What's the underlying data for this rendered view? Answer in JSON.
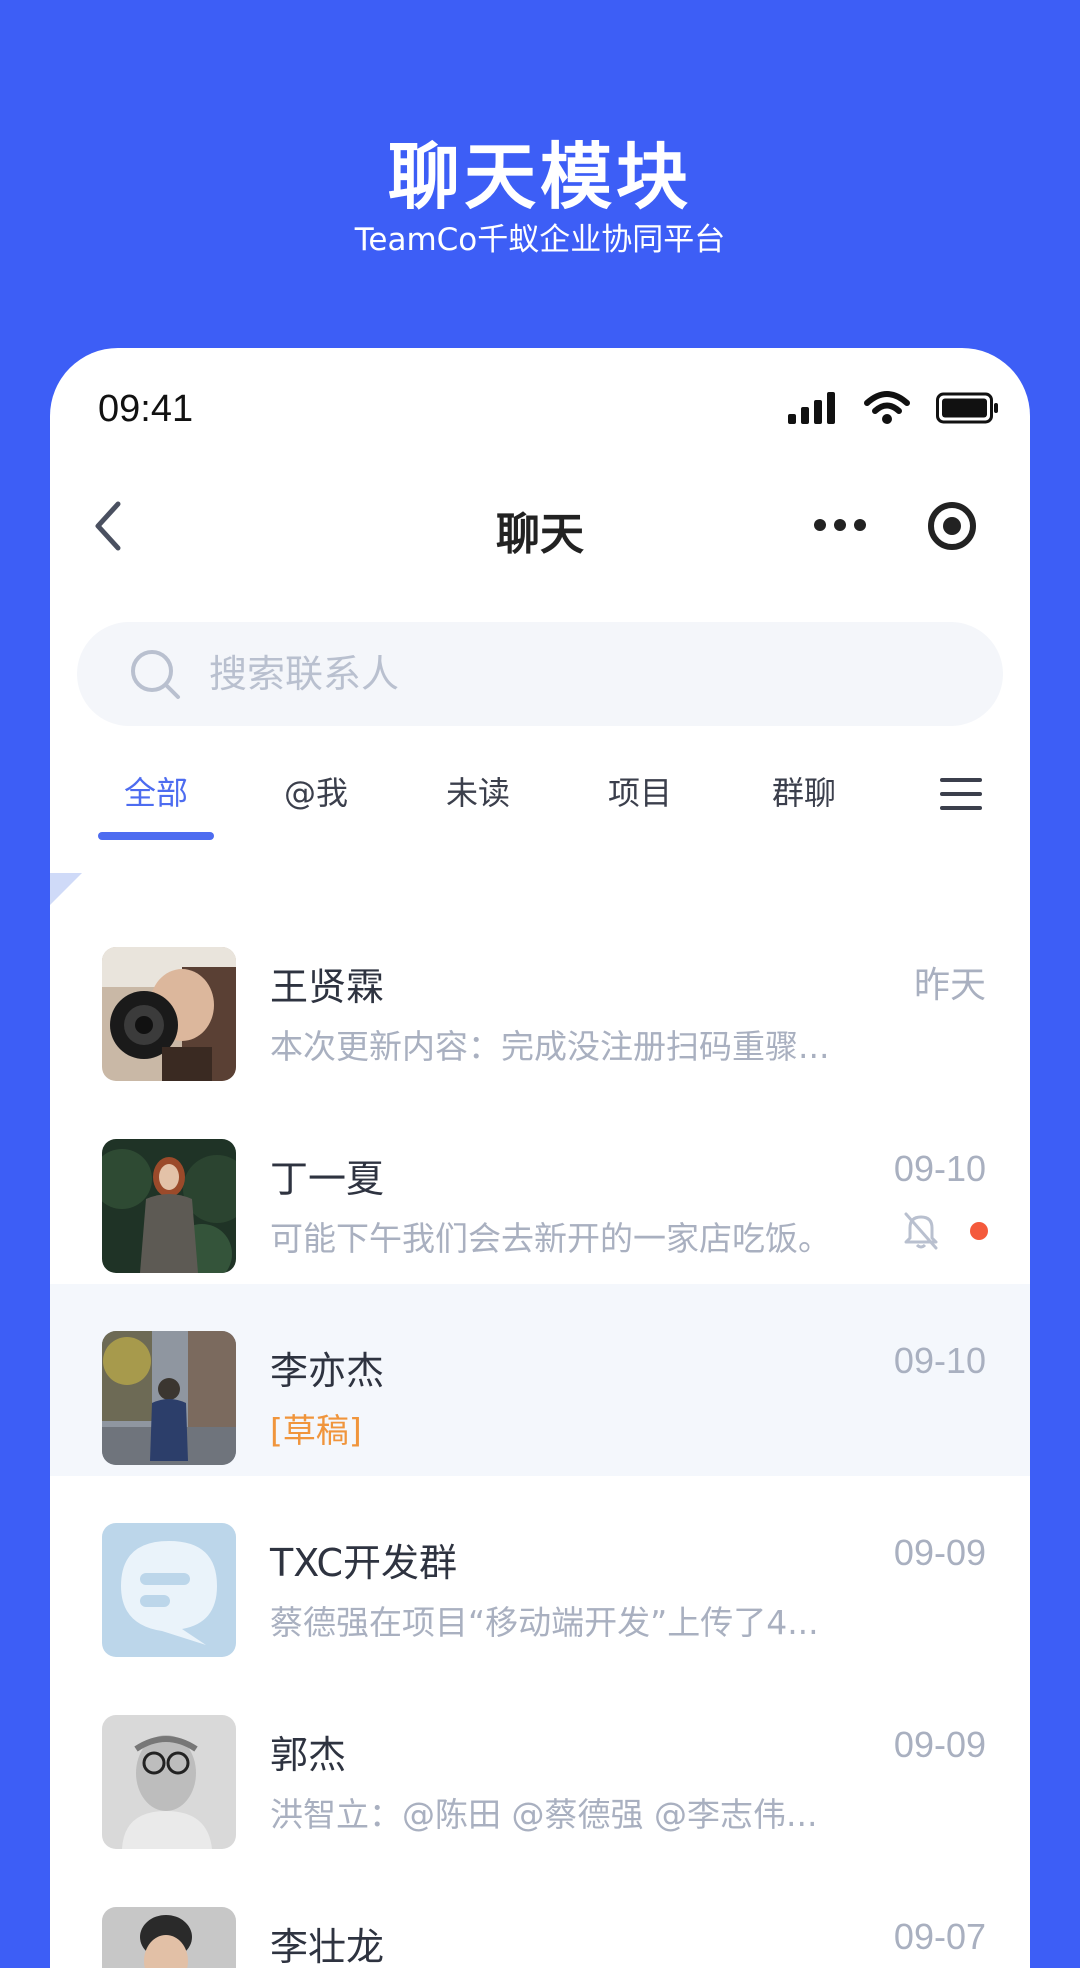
{
  "hero": {
    "title": "聊天模块",
    "subtitle": "TeamCo千蚁企业协同平台"
  },
  "status_bar": {
    "time": "09:41"
  },
  "navbar": {
    "title": "聊天"
  },
  "search": {
    "placeholder": "搜索联系人"
  },
  "tabs": [
    {
      "label": "全部",
      "active": true
    },
    {
      "label": "@我"
    },
    {
      "label": "未读"
    },
    {
      "label": "项目"
    },
    {
      "label": "群聊"
    }
  ],
  "colors": {
    "brand": "#3d5ef6",
    "accent": "#4d6cf0",
    "draft": "#f0953c",
    "unread": "#f45a3c"
  },
  "chats": [
    {
      "name": "王贤霖",
      "time": "昨天",
      "message": "本次更新内容：完成没注册扫码重骤..."
    },
    {
      "name": "丁一夏",
      "time": "09-10",
      "message": "可能下午我们会去新开的一家店吃饭。",
      "muted": true,
      "unread": true
    },
    {
      "name": "李亦杰",
      "time": "09-10",
      "message": "[草稿]",
      "draft": true,
      "selected": true
    },
    {
      "name": "TXC开发群",
      "time": "09-09",
      "message": "蔡德强在项目“移动端开发”上传了4..."
    },
    {
      "name": "郭杰",
      "time": "09-09",
      "message": "洪智立：@陈田  @蔡德强 @李志伟..."
    },
    {
      "name": "李壮龙",
      "time": "09-07",
      "message": ""
    }
  ]
}
